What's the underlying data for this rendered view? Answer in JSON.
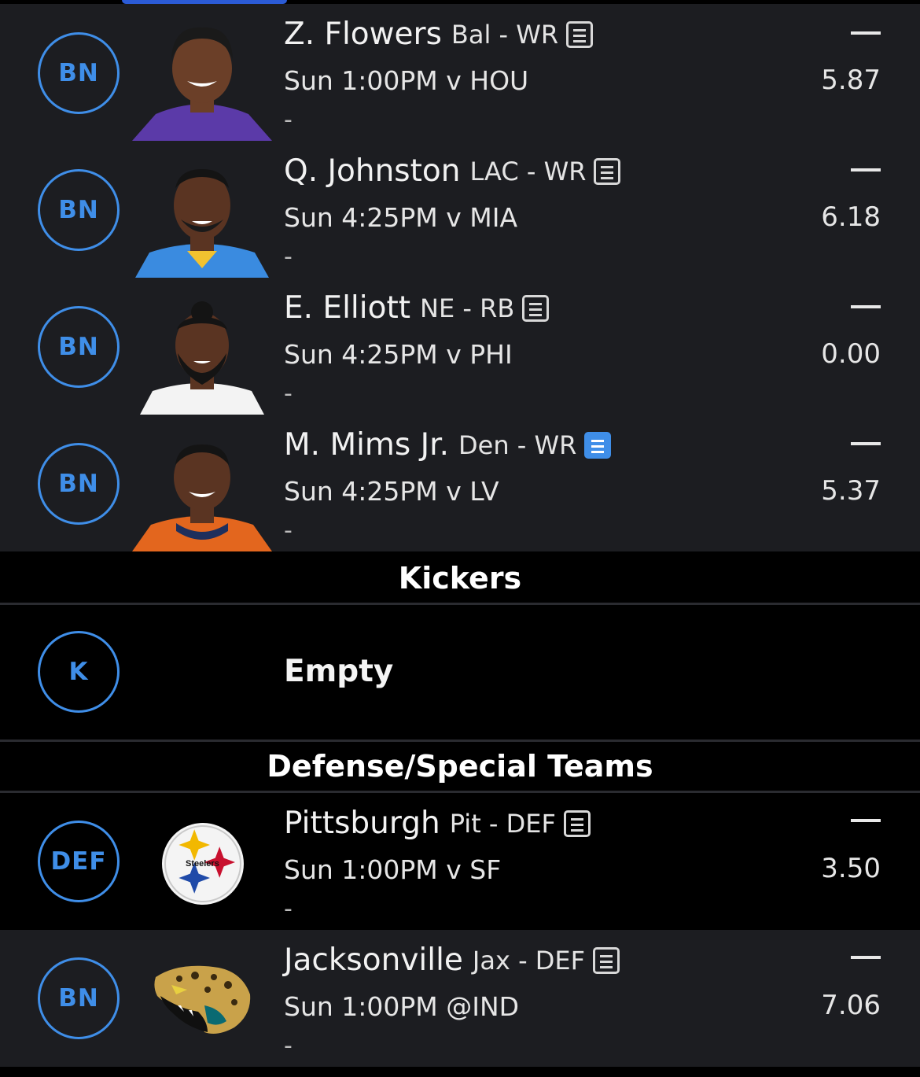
{
  "players": [
    {
      "slot": "BN",
      "name": "Z. Flowers",
      "team_pos": "Bal - WR",
      "game": "Sun 1:00PM v HOU",
      "status": "-",
      "projection": "5.87",
      "news_icon": "news-icon",
      "jersey_color": "#5b3aa8"
    },
    {
      "slot": "BN",
      "name": "Q. Johnston",
      "team_pos": "LAC - WR",
      "game": "Sun 4:25PM v MIA",
      "status": "-",
      "projection": "6.18",
      "news_icon": "news-icon",
      "jersey_color": "#3a8be0"
    },
    {
      "slot": "BN",
      "name": "E. Elliott",
      "team_pos": "NE - RB",
      "game": "Sun 4:25PM v PHI",
      "status": "-",
      "projection": "0.00",
      "news_icon": "news-icon",
      "jersey_color": "#f3f3f3"
    },
    {
      "slot": "BN",
      "name": "M. Mims Jr.",
      "team_pos": "Den - WR",
      "game": "Sun 4:25PM v LV",
      "status": "-",
      "projection": "5.37",
      "news_icon": "news-icon-new",
      "jersey_color": "#e3661e"
    }
  ],
  "kickers": {
    "header": "Kickers",
    "slot": "K",
    "empty_label": "Empty"
  },
  "defense": {
    "header": "Defense/Special Teams",
    "teams": [
      {
        "slot": "DEF",
        "name": "Pittsburgh",
        "team_pos": "Pit - DEF",
        "game": "Sun 1:00PM v SF",
        "status": "-",
        "projection": "3.50",
        "logo_text": "Steelers"
      },
      {
        "slot": "BN",
        "name": "Jacksonville",
        "team_pos": "Jax - DEF",
        "game": "Sun 1:00PM @IND",
        "status": "-",
        "projection": "7.06",
        "logo": "jaguar-logo"
      }
    ]
  },
  "colors": {
    "accent": "#3f8ee8",
    "row_bg": "#1c1d21",
    "page_bg": "#000000"
  }
}
